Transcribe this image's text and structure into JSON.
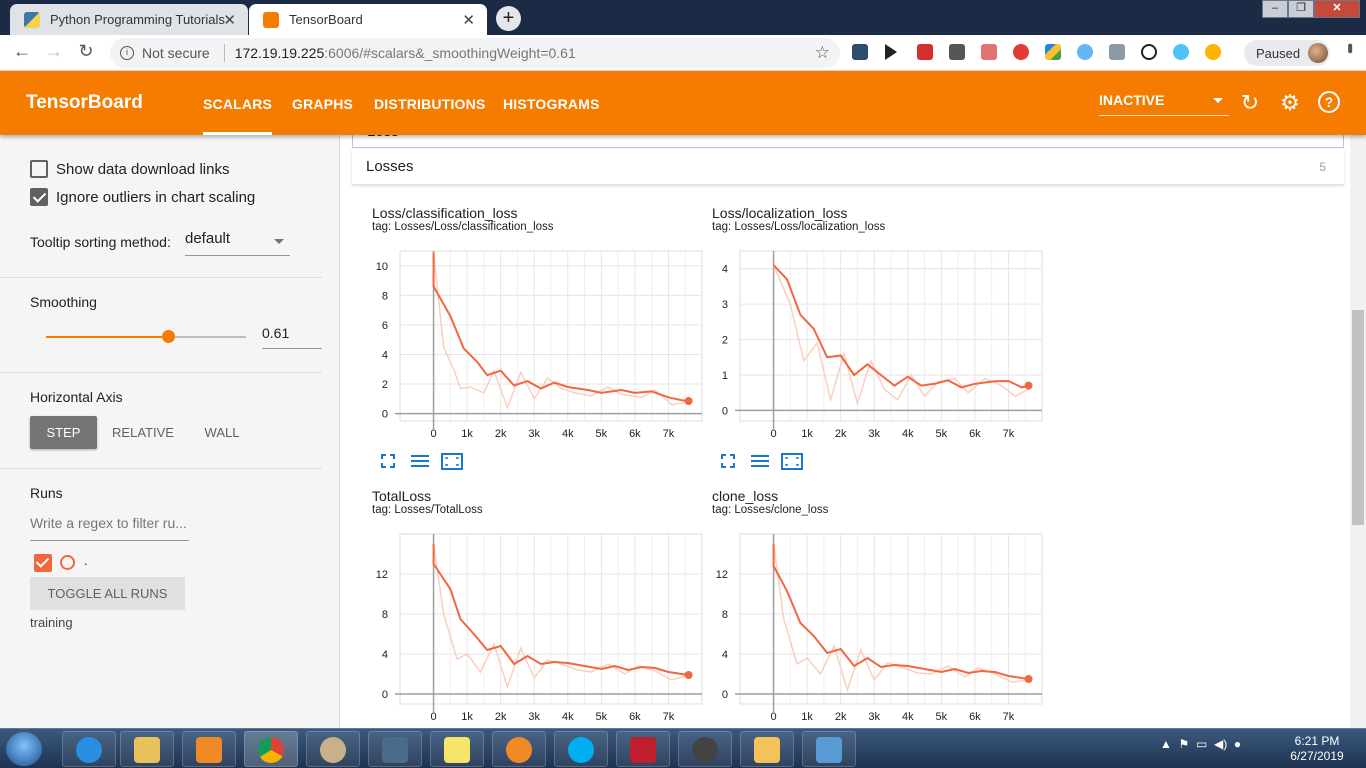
{
  "browser": {
    "tabs": [
      {
        "title": "Python Programming Tutorials",
        "close": "✕"
      },
      {
        "title": "TensorBoard",
        "close": "✕"
      }
    ],
    "new_tab": "+",
    "address": {
      "security_label": "Not secure",
      "host": "172.19.19.225",
      "rest": ":6006/#scalars&_smoothingWeight=0.61"
    },
    "profile_status": "Paused"
  },
  "tensorboard": {
    "logo": "TensorBoard",
    "tabs": [
      "SCALARS",
      "GRAPHS",
      "DISTRIBUTIONS",
      "HISTOGRAMS"
    ],
    "active_tab": "SCALARS",
    "status": "INACTIVE"
  },
  "sidebar": {
    "show_download_links": {
      "label": "Show data download links",
      "checked": false
    },
    "ignore_outliers": {
      "label": "Ignore outliers in chart scaling",
      "checked": true
    },
    "tooltip_sorting": {
      "label": "Tooltip sorting method:",
      "value": "default"
    },
    "smoothing": {
      "label": "Smoothing",
      "value": "0.61",
      "fraction": 0.61
    },
    "horizontal_axis": {
      "label": "Horizontal Axis",
      "options": [
        "STEP",
        "RELATIVE",
        "WALL"
      ],
      "selected": "STEP"
    },
    "runs": {
      "label": "Runs",
      "filter_placeholder": "Write a regex to filter ru...",
      "run_name": ".",
      "toggle_label": "TOGGLE ALL RUNS",
      "training_label": "training"
    }
  },
  "main": {
    "partial_category": "Loss",
    "category": {
      "name": "Losses",
      "count": "5"
    }
  },
  "colors": {
    "accent": "#f57c00",
    "line": "#f1673f",
    "line_raw": "#fbcfc0"
  },
  "chart_data": [
    {
      "type": "line",
      "title": "Loss/classification_loss",
      "tag": "tag: Losses/Loss/classification_loss",
      "ylim": [
        -0.5,
        11
      ],
      "yticks": [
        0,
        2,
        4,
        6,
        8,
        10
      ],
      "xlim": [
        -1000,
        8000
      ],
      "xticks": [
        0,
        1000,
        2000,
        3000,
        4000,
        5000,
        6000,
        7000
      ],
      "xtick_labels": [
        "0",
        "1k",
        "2k",
        "3k",
        "4k",
        "5k",
        "6k",
        "7k"
      ],
      "series": [
        {
          "values_smoothed": [
            [
              0,
              10.9
            ],
            [
              0,
              8.6
            ],
            [
              500,
              6.6
            ],
            [
              900,
              4.4
            ],
            [
              1300,
              3.5
            ],
            [
              1600,
              2.6
            ],
            [
              2000,
              2.9
            ],
            [
              2400,
              1.9
            ],
            [
              2800,
              2.2
            ],
            [
              3200,
              1.7
            ],
            [
              3600,
              2.1
            ],
            [
              4000,
              1.8
            ],
            [
              4600,
              1.6
            ],
            [
              5000,
              1.4
            ],
            [
              5600,
              1.6
            ],
            [
              6000,
              1.4
            ],
            [
              6500,
              1.5
            ],
            [
              7000,
              1.1
            ],
            [
              7400,
              0.9
            ],
            [
              7600,
              0.85
            ]
          ],
          "values_raw": [
            [
              0,
              10.9
            ],
            [
              300,
              4.5
            ],
            [
              600,
              3.0
            ],
            [
              800,
              1.7
            ],
            [
              1100,
              1.8
            ],
            [
              1500,
              1.4
            ],
            [
              1800,
              2.9
            ],
            [
              2200,
              0.4
            ],
            [
              2600,
              2.8
            ],
            [
              3000,
              1.0
            ],
            [
              3400,
              2.4
            ],
            [
              3800,
              1.7
            ],
            [
              4200,
              1.4
            ],
            [
              4700,
              1.2
            ],
            [
              5200,
              1.8
            ],
            [
              5600,
              1.3
            ],
            [
              6200,
              1.1
            ],
            [
              6600,
              1.6
            ],
            [
              7100,
              0.6
            ],
            [
              7600,
              0.8
            ]
          ]
        }
      ]
    },
    {
      "type": "line",
      "title": "Loss/localization_loss",
      "tag": "tag: Losses/Loss/localization_loss",
      "ylim": [
        -0.3,
        4.5
      ],
      "yticks": [
        0,
        1,
        2,
        3,
        4
      ],
      "xlim": [
        -1000,
        8000
      ],
      "xticks": [
        0,
        1000,
        2000,
        3000,
        4000,
        5000,
        6000,
        7000
      ],
      "xtick_labels": [
        "0",
        "1k",
        "2k",
        "3k",
        "4k",
        "5k",
        "6k",
        "7k"
      ],
      "series": [
        {
          "values_smoothed": [
            [
              0,
              4.1
            ],
            [
              400,
              3.7
            ],
            [
              800,
              2.7
            ],
            [
              1200,
              2.3
            ],
            [
              1600,
              1.5
            ],
            [
              2000,
              1.55
            ],
            [
              2400,
              1.0
            ],
            [
              2800,
              1.3
            ],
            [
              3200,
              1.0
            ],
            [
              3600,
              0.7
            ],
            [
              4000,
              0.95
            ],
            [
              4400,
              0.7
            ],
            [
              4800,
              0.75
            ],
            [
              5200,
              0.85
            ],
            [
              5600,
              0.65
            ],
            [
              6000,
              0.75
            ],
            [
              6600,
              0.82
            ],
            [
              7000,
              0.83
            ],
            [
              7400,
              0.65
            ],
            [
              7600,
              0.7
            ]
          ],
          "values_raw": [
            [
              0,
              4.1
            ],
            [
              500,
              3.0
            ],
            [
              900,
              1.4
            ],
            [
              1300,
              1.9
            ],
            [
              1700,
              0.3
            ],
            [
              2100,
              1.6
            ],
            [
              2500,
              0.2
            ],
            [
              2900,
              1.4
            ],
            [
              3300,
              0.6
            ],
            [
              3700,
              0.3
            ],
            [
              4100,
              1.0
            ],
            [
              4500,
              0.4
            ],
            [
              4900,
              0.8
            ],
            [
              5400,
              0.9
            ],
            [
              5800,
              0.5
            ],
            [
              6300,
              0.9
            ],
            [
              6800,
              0.7
            ],
            [
              7200,
              0.4
            ],
            [
              7600,
              0.6
            ]
          ]
        }
      ]
    },
    {
      "type": "line",
      "title": "TotalLoss",
      "tag": "tag: Losses/TotalLoss",
      "ylim": [
        -1,
        16
      ],
      "yticks": [
        0,
        4,
        8,
        12
      ],
      "xlim": [
        -1000,
        8000
      ],
      "xticks": [
        0,
        1000,
        2000,
        3000,
        4000,
        5000,
        6000,
        7000
      ],
      "xtick_labels": [
        "0",
        "1k",
        "2k",
        "3k",
        "4k",
        "5k",
        "6k",
        "7k"
      ],
      "series": [
        {
          "values_smoothed": [
            [
              0,
              15.0
            ],
            [
              0,
              13.0
            ],
            [
              500,
              10.5
            ],
            [
              800,
              7.5
            ],
            [
              1200,
              6.0
            ],
            [
              1600,
              4.4
            ],
            [
              2000,
              4.8
            ],
            [
              2400,
              3.0
            ],
            [
              2800,
              3.8
            ],
            [
              3200,
              3.0
            ],
            [
              3600,
              3.2
            ],
            [
              4000,
              3.1
            ],
            [
              4500,
              2.8
            ],
            [
              5000,
              2.5
            ],
            [
              5400,
              2.8
            ],
            [
              5800,
              2.4
            ],
            [
              6200,
              2.7
            ],
            [
              6600,
              2.6
            ],
            [
              7000,
              2.2
            ],
            [
              7600,
              1.9
            ]
          ],
          "values_raw": [
            [
              0,
              15.0
            ],
            [
              300,
              8.0
            ],
            [
              700,
              3.5
            ],
            [
              1000,
              4.0
            ],
            [
              1400,
              2.2
            ],
            [
              1800,
              5.0
            ],
            [
              2200,
              0.7
            ],
            [
              2600,
              4.6
            ],
            [
              3000,
              1.6
            ],
            [
              3400,
              3.4
            ],
            [
              3800,
              3.0
            ],
            [
              4300,
              2.4
            ],
            [
              4700,
              2.2
            ],
            [
              5200,
              3.0
            ],
            [
              5700,
              2.0
            ],
            [
              6100,
              2.8
            ],
            [
              6600,
              2.3
            ],
            [
              7100,
              1.4
            ],
            [
              7600,
              1.9
            ]
          ]
        }
      ]
    },
    {
      "type": "line",
      "title": "clone_loss",
      "tag": "tag: Losses/clone_loss",
      "ylim": [
        -1,
        16
      ],
      "yticks": [
        0,
        4,
        8,
        12
      ],
      "xlim": [
        -1000,
        8000
      ],
      "xticks": [
        0,
        1000,
        2000,
        3000,
        4000,
        5000,
        6000,
        7000
      ],
      "xtick_labels": [
        "0",
        "1k",
        "2k",
        "3k",
        "4k",
        "5k",
        "6k",
        "7k"
      ],
      "series": [
        {
          "values_smoothed": [
            [
              0,
              15.0
            ],
            [
              0,
              12.8
            ],
            [
              400,
              10.3
            ],
            [
              800,
              7.1
            ],
            [
              1200,
              5.8
            ],
            [
              1600,
              4.1
            ],
            [
              2000,
              4.5
            ],
            [
              2400,
              2.8
            ],
            [
              2800,
              3.6
            ],
            [
              3200,
              2.7
            ],
            [
              3600,
              2.9
            ],
            [
              4000,
              2.8
            ],
            [
              4500,
              2.5
            ],
            [
              5000,
              2.2
            ],
            [
              5400,
              2.5
            ],
            [
              5800,
              2.1
            ],
            [
              6200,
              2.3
            ],
            [
              6600,
              2.2
            ],
            [
              7000,
              1.8
            ],
            [
              7600,
              1.5
            ]
          ],
          "values_raw": [
            [
              0,
              15.0
            ],
            [
              300,
              7.6
            ],
            [
              700,
              3.0
            ],
            [
              1000,
              3.6
            ],
            [
              1400,
              2.0
            ],
            [
              1800,
              4.8
            ],
            [
              2200,
              0.4
            ],
            [
              2600,
              4.4
            ],
            [
              3000,
              1.4
            ],
            [
              3400,
              3.1
            ],
            [
              3800,
              2.7
            ],
            [
              4300,
              2.1
            ],
            [
              4700,
              2.0
            ],
            [
              5200,
              2.8
            ],
            [
              5700,
              1.7
            ],
            [
              6100,
              2.6
            ],
            [
              6600,
              2.0
            ],
            [
              7100,
              1.2
            ],
            [
              7600,
              1.4
            ]
          ]
        }
      ]
    }
  ],
  "taskbar": {
    "time": "6:21 PM",
    "date": "6/27/2019"
  }
}
